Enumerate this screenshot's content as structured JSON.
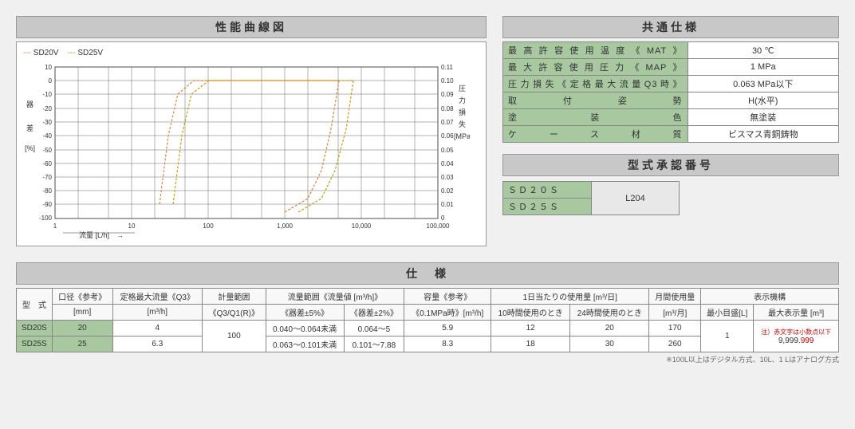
{
  "headers": {
    "perf_curve": "性能曲線図",
    "common_spec": "共通仕様",
    "approval_no": "型式承認番号",
    "spec": "仕　様"
  },
  "legend": {
    "sd20v": "SD20V",
    "sd25v": "SD25V"
  },
  "chart_labels": {
    "y_left": "器　差",
    "y_left_unit": "[%]",
    "y_right": "圧力損失",
    "y_right_unit": "[MPa]",
    "x": "流量 [L/h]",
    "arrow": "→"
  },
  "chart_data": {
    "type": "line",
    "xscale": "log",
    "xlim": [
      1,
      100000
    ],
    "y_left_lim": [
      -100,
      10
    ],
    "y_right_lim": [
      0,
      0.11
    ],
    "x_ticks": [
      1,
      10,
      100,
      1000,
      10000,
      100000
    ],
    "y_left_ticks": [
      10,
      0,
      -10,
      -20,
      -30,
      -40,
      -50,
      -60,
      -70,
      -80,
      -90,
      -100
    ],
    "y_right_ticks": [
      0.11,
      0.1,
      0.09,
      0.08,
      0.07,
      0.06,
      0.05,
      0.04,
      0.03,
      0.02,
      0.01,
      0
    ],
    "series": [
      {
        "name": "SD20V",
        "color": "#e08030",
        "error_curve_x": [
          23,
          30,
          40,
          64,
          100,
          1000,
          2500,
          4000,
          5000
        ],
        "error_curve_y": [
          -90,
          -40,
          -10,
          0,
          0,
          0,
          0,
          0,
          0
        ],
        "loss_curve_x": [
          1000,
          2000,
          3000,
          4000,
          5000
        ],
        "loss_curve_mpa": [
          0.005,
          0.015,
          0.035,
          0.065,
          0.1
        ]
      },
      {
        "name": "SD25V",
        "color": "#c0a000",
        "error_curve_x": [
          35,
          45,
          60,
          101,
          200,
          2000,
          4000,
          6300,
          7880
        ],
        "error_curve_y": [
          -90,
          -40,
          -10,
          0,
          0,
          0,
          0,
          0,
          0
        ],
        "loss_curve_x": [
          1500,
          3000,
          4500,
          6300,
          7880
        ],
        "loss_curve_mpa": [
          0.005,
          0.015,
          0.035,
          0.065,
          0.1
        ]
      }
    ]
  },
  "common_spec_rows": [
    {
      "label": "最高許容使用温度《MAT》",
      "value": "30 ℃"
    },
    {
      "label": "最大許容使用圧力《MAP》",
      "value": "1 MPa"
    },
    {
      "label": "圧力損失《定格最大流量Q3時》",
      "value": "0.063 MPa以下"
    },
    {
      "label": "取付姿勢",
      "value": "H(水平)"
    },
    {
      "label": "塗装色",
      "value": "無塗装"
    },
    {
      "label": "ケース材質",
      "value": "ビスマス青銅鋳物"
    }
  ],
  "approval": {
    "models": [
      "ＳＤ２０Ｓ",
      "ＳＤ２５Ｓ"
    ],
    "code": "L204"
  },
  "lower": {
    "col_headers": {
      "model": "型　式",
      "dia": "口径《参考》",
      "dia_unit": "[mm]",
      "q3": "定格最大流量《Q3》",
      "q3_unit": "[m³/h]",
      "range": "計量範囲",
      "range_unit": "《Q3/Q1(R)》",
      "flow_range": "流量範囲《流量値 [m³/h]》",
      "err5": "《器差±5%》",
      "err2": "《器差±2%》",
      "cap": "容量《参考》",
      "cap_detail": "《0.1MPa時》[m³/h]",
      "daily": "1日当たりの使用量 [m³/日]",
      "d10": "10時間使用のとき",
      "d24": "24時間使用のとき",
      "monthly": "月間使用量",
      "monthly_unit": "[m³/月]",
      "display": "表示機構",
      "min_scale": "最小目盛[L]",
      "max_disp": "最大表示量 [m³]"
    },
    "rows": [
      {
        "model": "SD20S",
        "dia": "20",
        "q3": "4",
        "range": "100",
        "err5": "0.040～0.064未満",
        "err2": "0.064～5",
        "cap": "5.9",
        "d10": "12",
        "d24": "20",
        "monthly": "170",
        "min_scale": "1",
        "max_disp_note": "注）赤文字は小数点以下",
        "max_disp": "9,999.999"
      },
      {
        "model": "SD25S",
        "dia": "25",
        "q3": "6.3",
        "range": "100",
        "err5": "0.063～0.101未満",
        "err2": "0.101～7.88",
        "cap": "8.3",
        "d10": "18",
        "d24": "30",
        "monthly": "260",
        "min_scale": "1",
        "max_disp": "9,999.999"
      }
    ],
    "footnote": "※100L以上はデジタル方式、10L、1 Lはアナログ方式"
  }
}
